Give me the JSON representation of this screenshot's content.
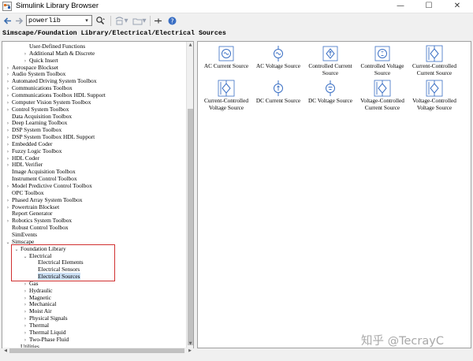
{
  "window": {
    "title": "Simulink Library Browser",
    "controls": {
      "minimize": "—",
      "maximize": "☐",
      "close": "✕"
    }
  },
  "toolbar": {
    "back_icon": "back-arrow-icon",
    "forward_icon": "forward-arrow-icon",
    "search_value": "powerlib",
    "search_dropdown": "▾",
    "search_options_icon": "search-options-icon",
    "new_model_icon": "new-model-icon",
    "open_icon": "open-folder-icon",
    "pin_icon": "pin-icon",
    "help_icon": "help-icon"
  },
  "breadcrumb": "Simscape/Foundation Library/Electrical/Electrical Sources",
  "tree": [
    {
      "label": "User-Defined Functions",
      "indent": 2,
      "arrow": ""
    },
    {
      "label": "Additional Math & Discrete",
      "indent": 2,
      "arrow": "›"
    },
    {
      "label": "Quick Insert",
      "indent": 2,
      "arrow": "›"
    },
    {
      "label": "Aerospace Blockset",
      "indent": 0,
      "arrow": "›"
    },
    {
      "label": "Audio System Toolbox",
      "indent": 0,
      "arrow": "›"
    },
    {
      "label": "Automated Driving System Toolbox",
      "indent": 0,
      "arrow": "›"
    },
    {
      "label": "Communications Toolbox",
      "indent": 0,
      "arrow": "›"
    },
    {
      "label": "Communications Toolbox HDL Support",
      "indent": 0,
      "arrow": "›"
    },
    {
      "label": "Computer Vision System Toolbox",
      "indent": 0,
      "arrow": "›"
    },
    {
      "label": "Control System Toolbox",
      "indent": 0,
      "arrow": "›"
    },
    {
      "label": "Data Acquisition Toolbox",
      "indent": 0,
      "arrow": ""
    },
    {
      "label": "Deep Learning Toolbox",
      "indent": 0,
      "arrow": "›"
    },
    {
      "label": "DSP System Toolbox",
      "indent": 0,
      "arrow": "›"
    },
    {
      "label": "DSP System Toolbox HDL Support",
      "indent": 0,
      "arrow": "›"
    },
    {
      "label": "Embedded Coder",
      "indent": 0,
      "arrow": "›"
    },
    {
      "label": "Fuzzy Logic Toolbox",
      "indent": 0,
      "arrow": "›"
    },
    {
      "label": "HDL Coder",
      "indent": 0,
      "arrow": "›"
    },
    {
      "label": "HDL Verifier",
      "indent": 0,
      "arrow": "›"
    },
    {
      "label": "Image Acquisition Toolbox",
      "indent": 0,
      "arrow": ""
    },
    {
      "label": "Instrument Control Toolbox",
      "indent": 0,
      "arrow": ""
    },
    {
      "label": "Model Predictive Control Toolbox",
      "indent": 0,
      "arrow": "›"
    },
    {
      "label": "OPC Toolbox",
      "indent": 0,
      "arrow": ""
    },
    {
      "label": "Phased Array System Toolbox",
      "indent": 0,
      "arrow": "›"
    },
    {
      "label": "Powertrain Blockset",
      "indent": 0,
      "arrow": "›"
    },
    {
      "label": "Report Generator",
      "indent": 0,
      "arrow": ""
    },
    {
      "label": "Robotics System Toolbox",
      "indent": 0,
      "arrow": "›"
    },
    {
      "label": "Robust Control Toolbox",
      "indent": 0,
      "arrow": ""
    },
    {
      "label": "SimEvents",
      "indent": 0,
      "arrow": ""
    },
    {
      "label": "Simscape",
      "indent": 0,
      "arrow": "⌄"
    },
    {
      "label": "Foundation Library",
      "indent": 1,
      "arrow": "⌄"
    },
    {
      "label": "Electrical",
      "indent": 2,
      "arrow": "⌄"
    },
    {
      "label": "Electrical Elements",
      "indent": 3,
      "arrow": ""
    },
    {
      "label": "Electrical Sensors",
      "indent": 3,
      "arrow": ""
    },
    {
      "label": "Electrical Sources",
      "indent": 3,
      "arrow": "",
      "selected": true
    },
    {
      "label": "Gas",
      "indent": 2,
      "arrow": "›"
    },
    {
      "label": "Hydraulic",
      "indent": 2,
      "arrow": "›"
    },
    {
      "label": "Magnetic",
      "indent": 2,
      "arrow": "›"
    },
    {
      "label": "Mechanical",
      "indent": 2,
      "arrow": "›"
    },
    {
      "label": "Moist Air",
      "indent": 2,
      "arrow": "›"
    },
    {
      "label": "Physical Signals",
      "indent": 2,
      "arrow": "›"
    },
    {
      "label": "Thermal",
      "indent": 2,
      "arrow": "›"
    },
    {
      "label": "Thermal Liquid",
      "indent": 2,
      "arrow": "›"
    },
    {
      "label": "Two-Phase Fluid",
      "indent": 2,
      "arrow": "›"
    },
    {
      "label": "Utilities",
      "indent": 1,
      "arrow": ""
    }
  ],
  "blocks": [
    {
      "lines": [
        "AC Current Source"
      ],
      "icon": "ac-current-source-icon"
    },
    {
      "lines": [
        "AC Voltage Source"
      ],
      "icon": "ac-voltage-source-icon"
    },
    {
      "lines": [
        "Controlled Current",
        "Source"
      ],
      "icon": "controlled-current-source-icon"
    },
    {
      "lines": [
        "Controlled Voltage",
        "Source"
      ],
      "icon": "controlled-voltage-source-icon"
    },
    {
      "lines": [
        "Current-Controlled",
        "Current Source"
      ],
      "icon": "current-controlled-current-source-icon"
    },
    {
      "lines": [
        "Current-Controlled",
        "Voltage Source"
      ],
      "icon": "current-controlled-voltage-source-icon"
    },
    {
      "lines": [
        "DC Current Source"
      ],
      "icon": "dc-current-source-icon"
    },
    {
      "lines": [
        "DC Voltage Source"
      ],
      "icon": "dc-voltage-source-icon"
    },
    {
      "lines": [
        "Voltage-Controlled",
        "Current Source"
      ],
      "icon": "voltage-controlled-current-source-icon"
    },
    {
      "lines": [
        "Voltage-Controlled",
        "Voltage Source"
      ],
      "icon": "voltage-controlled-voltage-source-icon"
    }
  ],
  "watermark": "知乎 @TecrayC",
  "colors": {
    "icon_blue": "#3a6fc4",
    "highlight_red": "#d03030",
    "selection": "#cce0f4"
  }
}
